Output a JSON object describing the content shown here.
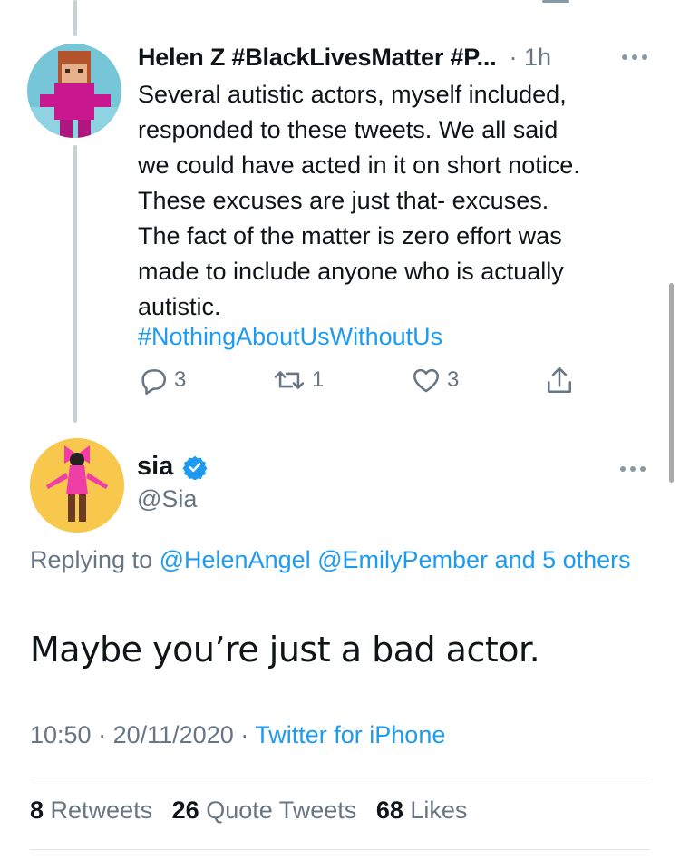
{
  "thread": {
    "parent_tweet": {
      "author_name": "Helen Z #BlackLivesMatter #P...",
      "time": "· 1h",
      "body_lines": [
        "Several autistic actors, myself included,",
        "responded to these tweets. We all said",
        "we could have acted in it on short notice.",
        "These excuses are just that- excuses.",
        "The fact of the matter is zero effort was",
        "made to include anyone who is actually",
        "autistic."
      ],
      "hashtag": "#NothingAboutUsWithoutUs",
      "actions": {
        "replies": "3",
        "retweets": "1",
        "likes": "3"
      }
    },
    "focused_tweet": {
      "author_name": "sia",
      "handle": "@Sia",
      "replying_prefix": "Replying to",
      "replying_mentions": "@HelenAngel @EmilyPember and 5 others",
      "text": "Maybe you’re just a bad actor.",
      "time": "10:50",
      "date": "20/11/2020",
      "source": "Twitter for iPhone",
      "stats": {
        "retweets_count": "8",
        "retweets_label": "Retweets",
        "quotes_count": "26",
        "quotes_label": "Quote Tweets",
        "likes_count": "68",
        "likes_label": "Likes"
      }
    }
  },
  "colors": {
    "link": "#1d9bf0",
    "secondary": "#687684",
    "verified": "#1d9bf0"
  },
  "icons": [
    "reply-icon",
    "retweet-icon",
    "like-icon",
    "share-icon",
    "verified-badge-icon",
    "more-options-icon"
  ]
}
